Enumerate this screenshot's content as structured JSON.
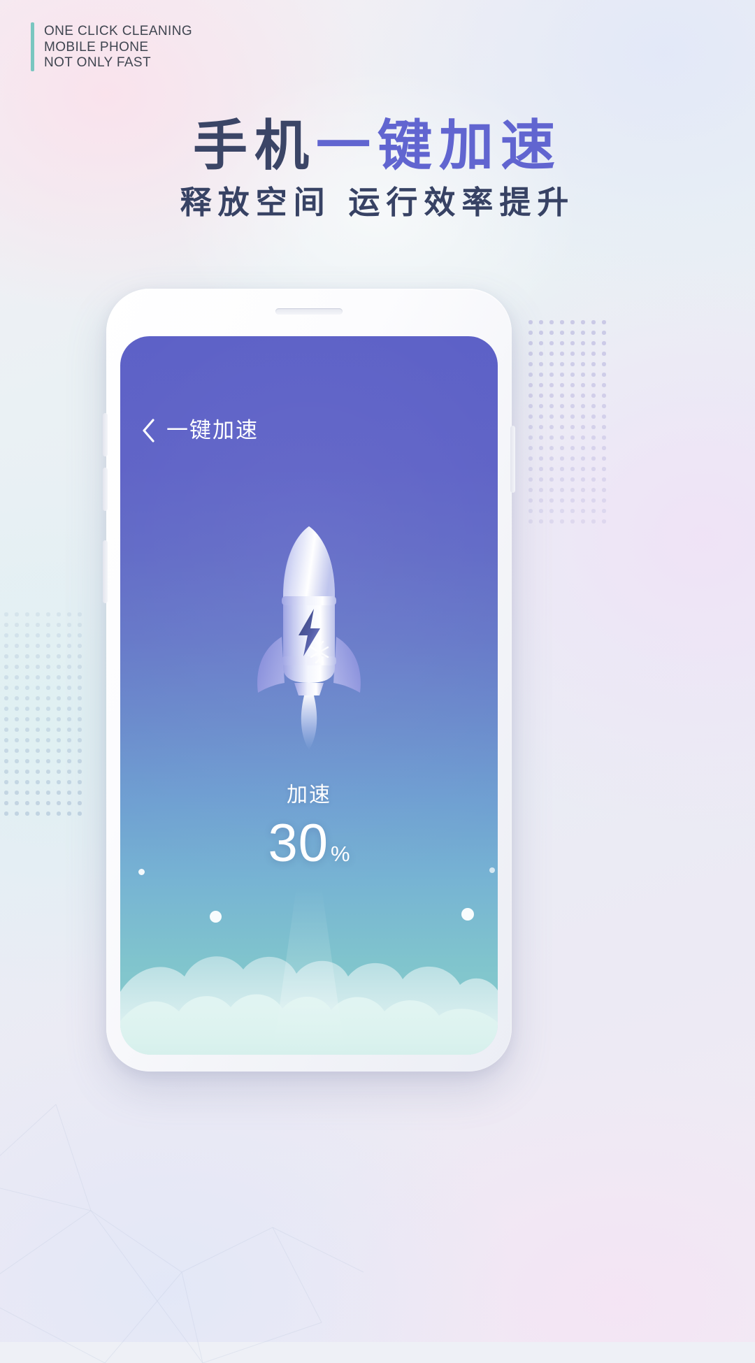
{
  "poster": {
    "caption": {
      "accent_color": "#79c6c0",
      "lines": [
        "ONE CLICK CLEANING",
        "MOBILE PHONE",
        "NOT ONLY FAST"
      ]
    },
    "headline": {
      "dark_part": "手机",
      "accent_part": "一键加速",
      "dark_color": "#3b4566",
      "accent_color": "#6165d0"
    },
    "subheadline": "释放空间 运行效率提升",
    "background_colors": {
      "base": "#eceef5",
      "pink_glow": "#fae2ec",
      "blue_glow": "#e2e8f8",
      "teal_glow": "#def0f2"
    }
  },
  "phone": {
    "frame_color": "#ffffff",
    "buttons": [
      "volume-up",
      "volume-down",
      "power",
      "side-right"
    ],
    "screen": {
      "gradient_top": "#5b5fc6",
      "gradient_mid": "#6a8bcc",
      "gradient_bottom": "#8cd0cd",
      "nav": {
        "back_icon": "chevron-left-icon",
        "title": "一键加速"
      },
      "illustration": {
        "name": "rocket-icon",
        "badge_icons": [
          "lightning-bolt-icon",
          "snowflake-icon"
        ],
        "body_color": "#eef0fb",
        "fin_color": "#8f95e0"
      },
      "status": {
        "label": "加速",
        "value": "30",
        "unit": "%"
      },
      "clouds_color": "#d9f0ee"
    }
  }
}
